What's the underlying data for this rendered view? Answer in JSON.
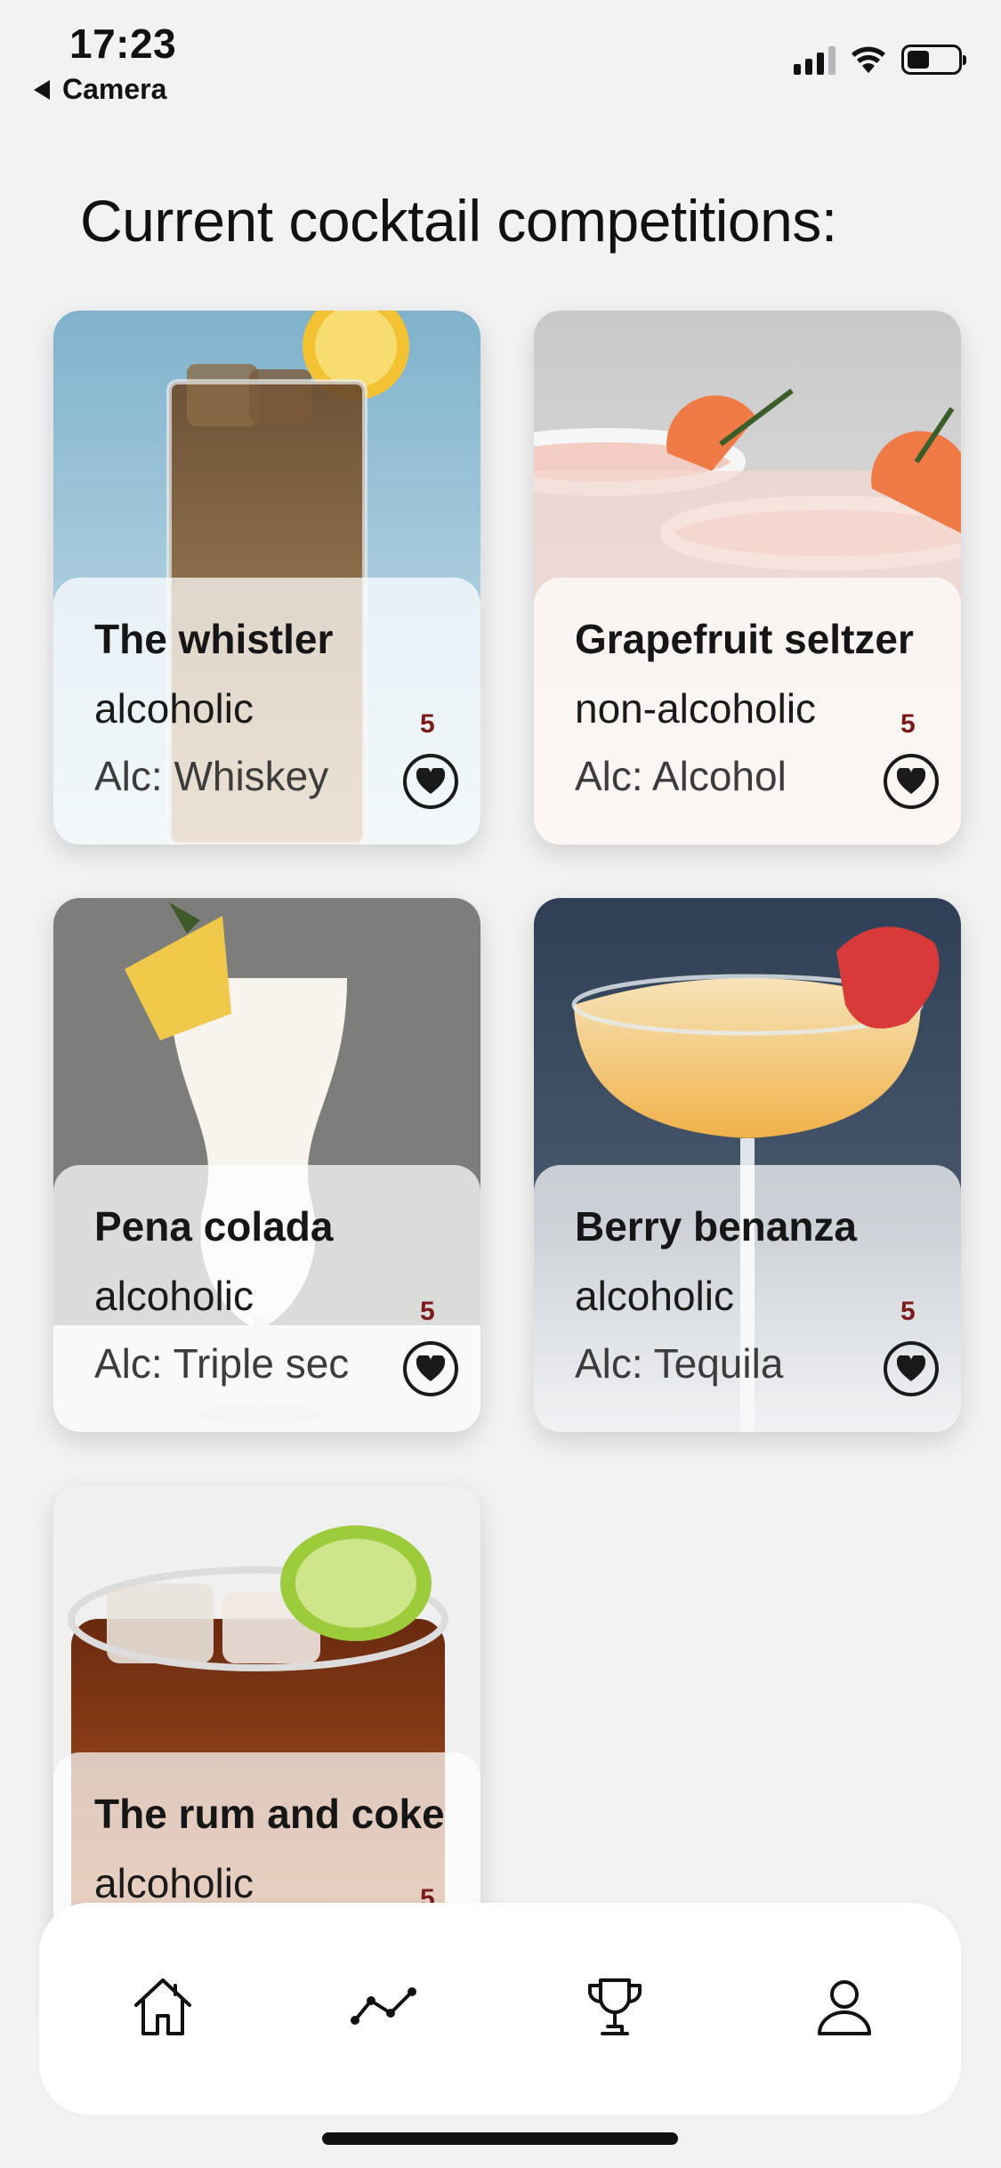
{
  "status_bar": {
    "time": "17:23",
    "back_label": "Camera"
  },
  "page": {
    "title": "Current cocktail competitions:"
  },
  "cocktails": [
    {
      "name": "The whistler",
      "type": "alcoholic",
      "alcohol": "Alc: Whiskey",
      "likes": "5"
    },
    {
      "name": "Grapefruit seltzer",
      "type": "non-alcoholic",
      "alcohol": "Alc: Alcohol",
      "likes": "5"
    },
    {
      "name": "Pena colada",
      "type": "alcoholic",
      "alcohol": "Alc: Triple sec",
      "likes": "5"
    },
    {
      "name": "Berry benanza",
      "type": "alcoholic",
      "alcohol": "Alc: Tequila",
      "likes": "5"
    },
    {
      "name": "The rum and coke",
      "type": "alcoholic",
      "alcohol": "",
      "likes": "5"
    }
  ],
  "tabbar": {
    "tabs": [
      {
        "icon": "home-icon"
      },
      {
        "icon": "trend-icon"
      },
      {
        "icon": "trophy-icon"
      },
      {
        "icon": "profile-icon"
      }
    ]
  },
  "colors": {
    "background": "#f2f2f3",
    "like_count": "#7a1a1a",
    "text": "#111111"
  }
}
